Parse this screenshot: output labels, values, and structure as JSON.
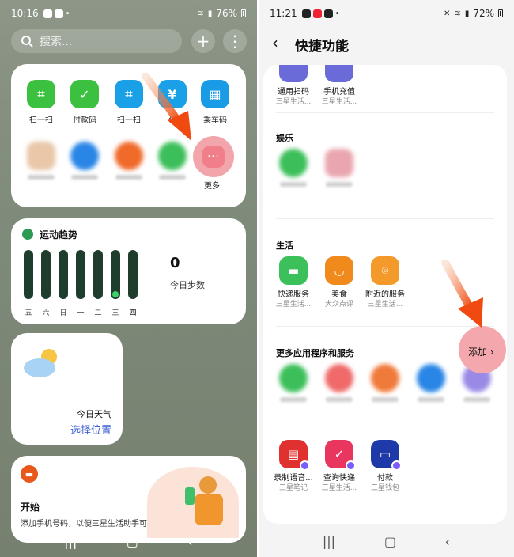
{
  "left": {
    "status": {
      "time": "10:16",
      "battery": "76%"
    },
    "search": {
      "placeholder": "搜索..."
    },
    "header_buttons": {
      "add": "+",
      "more": "⋮"
    },
    "quick_apps": [
      {
        "label": "扫一扫",
        "color": "#3cc03f"
      },
      {
        "label": "付款码",
        "color": "#3cc03f"
      },
      {
        "label": "扫一扫",
        "color": "#1aa0e6"
      },
      {
        "label": "付",
        "color": "#1aa0e6"
      },
      {
        "label": "乘车码",
        "color": "#1a9be6"
      }
    ],
    "more_label": "更多",
    "steps": {
      "title": "运动趋势",
      "count": "0",
      "count_label": "今日步数",
      "days": [
        "五",
        "六",
        "日",
        "一",
        "二",
        "三",
        "四"
      ]
    },
    "weather": {
      "title": "今日天气",
      "action": "选择位置"
    },
    "start": {
      "title": "开始",
      "desc": "添加手机号码，以便三星生活助手可以自动"
    }
  },
  "right": {
    "status": {
      "time": "11:21",
      "battery": "72%"
    },
    "title": "快捷功能",
    "top_items": [
      {
        "label": "通用扫码",
        "sub": "三星生活..."
      },
      {
        "label": "手机充值",
        "sub": "三星生活..."
      }
    ],
    "section_ent": "娱乐",
    "section_life": "生活",
    "life_items": [
      {
        "label": "快递服务",
        "sub": "三星生活...",
        "color": "#3cc05a"
      },
      {
        "label": "美食",
        "sub": "大众点评",
        "color": "#f08a1c"
      },
      {
        "label": "附近的服务",
        "sub": "三星生活...",
        "color": "#f49a2a"
      }
    ],
    "section_more": "更多应用程序和服务",
    "add_label": "添加",
    "bottom_items": [
      {
        "label": "录制语音...",
        "sub": "三星笔记",
        "color": "#e03030"
      },
      {
        "label": "查询快递",
        "sub": "三星生活...",
        "color": "#e8365f"
      },
      {
        "label": "付款",
        "sub": "三星钱包",
        "color": "#1e3aa8"
      }
    ]
  }
}
